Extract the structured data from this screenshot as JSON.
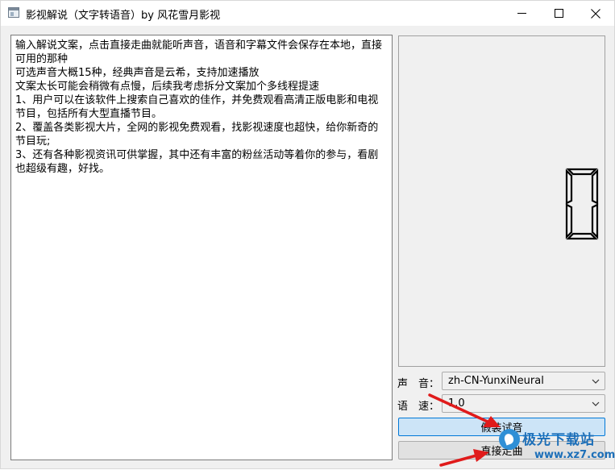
{
  "window": {
    "title": "影视解说（文字转语音）by 风花雪月影视",
    "icon": "app-window-icon"
  },
  "editor": {
    "text": "输入解说文案，点击直接走曲就能听声音，语音和字幕文件会保存在本地，直接可用的那种\n可选声音大概15种，经典声音是云希，支持加速播放\n文案太长可能会稍微有点慢，后续我考虑拆分文案加个多线程提速\n1、用户可以在该软件上搜索自己喜欢的佳作，并免费观看高清正版电影和电视节目，包括所有大型直播节目。\n2、覆盖各类影视大片，全网的影视免费观看，找影视速度也超快，给你新奇的节目玩;\n3、还有各种影视资讯可供掌握，其中还有丰富的粉丝活动等着你的参与，看剧也超级有趣，好找。"
  },
  "display": {
    "digit": "0"
  },
  "voice": {
    "label": "声　音：",
    "selected": "zh-CN-YunxiNeural"
  },
  "speed": {
    "label": "语　速：",
    "selected": "1.0"
  },
  "buttons": {
    "preview": "假装试音",
    "generate": "直接走曲"
  },
  "watermark": {
    "brand": "极光下载站",
    "url": "www.xz7.com"
  },
  "colors": {
    "accent": "#0078d7",
    "arrow": "#e01b1b",
    "watermark": "#1d6fb8"
  }
}
